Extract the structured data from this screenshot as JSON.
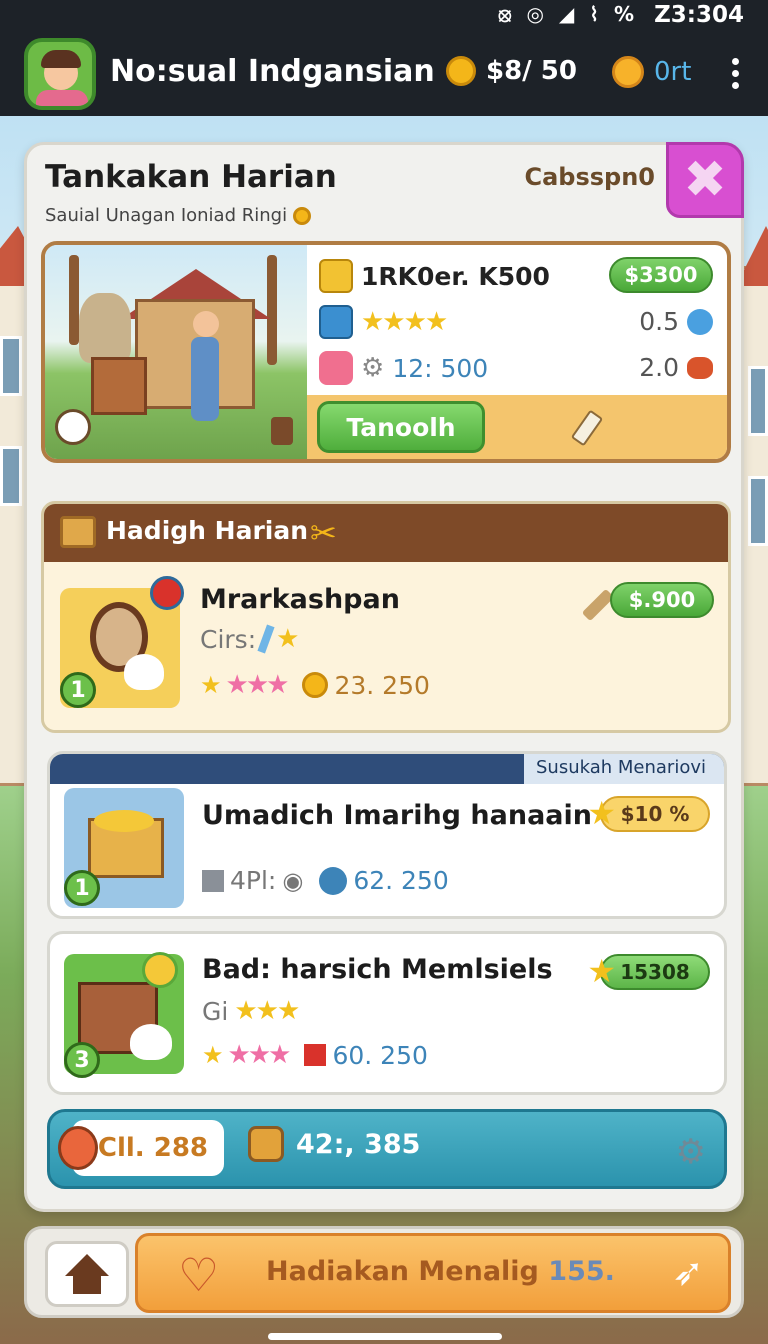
{
  "status_bar": {
    "time": "Z3:304",
    "icons_text": "⦻ ◎ ◢ ⌇ %"
  },
  "app": {
    "title": "No:sual Indgansian",
    "currency1": "$8/ 50",
    "currency2": "0rt"
  },
  "panel": {
    "title": "Tankakan Harian",
    "subtitle": "Sauial Unagan Ioniad Ringi",
    "tag": "Cabsspn0",
    "close_symbol": "✖"
  },
  "featured": {
    "headline": "1RK0er. K500",
    "price": "$3300",
    "row2_value": "0.5",
    "row3_value": "12: 500",
    "row3_right": "2.0",
    "button": "Tanoolh"
  },
  "daily_gift": {
    "header": "Hadigh Harian",
    "item": {
      "title": "Mrarkashpan",
      "subtitle": "Cirs:",
      "price": "$.900",
      "value": "23. 250",
      "badge": "1"
    }
  },
  "list": [
    {
      "banner": "Susukah Menariovi",
      "title": "Umadich Imarihg hanaain",
      "tag": "$10 %",
      "meta": "4Pl:",
      "value": "62. 250",
      "badge": "1"
    },
    {
      "title": "Bad: harsich Memlsiels",
      "tag": "15308",
      "subtitle": "Gi",
      "value": "60. 250",
      "badge": "3"
    }
  ],
  "summary": {
    "left": "Cll. 288",
    "mid": "42:, 385"
  },
  "bottom": {
    "button_text": "Hadiakan Menalig",
    "button_num": "155."
  },
  "colors": {
    "accent_green": "#4aa838",
    "close_magenta": "#d84fd1",
    "header_brown": "#7e4a28",
    "summary_teal": "#2b93ad",
    "orange": "#f29f3b"
  }
}
